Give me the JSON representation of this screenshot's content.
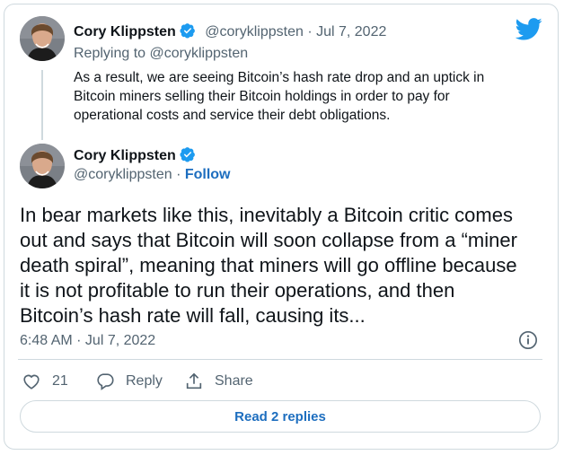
{
  "quoted_tweet": {
    "author_name": "Cory Klippsten",
    "handle": "@coryklippsten",
    "date_separator": " · ",
    "date": "Jul 7, 2022",
    "replying_prefix": "Replying to ",
    "replying_to": "@coryklippsten",
    "text_lines": [
      "As a result, we are seeing Bitcoin’s hash rate drop and an uptick in",
      "Bitcoin miners selling their Bitcoin holdings in order to pay for",
      "operational costs and service their debt obligations."
    ]
  },
  "main_tweet": {
    "author_name": "Cory Klippsten",
    "handle": "@coryklippsten",
    "follow_separator": " · ",
    "follow_label": "Follow",
    "text_lines": [
      "In bear markets like this, inevitably a Bitcoin critic comes",
      "out and says that Bitcoin will soon collapse from a “miner",
      "death spiral”, meaning that miners will go offline because",
      "it is not profitable to run their operations, and then",
      "Bitcoin’s hash rate will fall, causing its..."
    ],
    "timestamp": "6:48 AM · Jul 7, 2022"
  },
  "actions": {
    "like_count": "21",
    "reply_label": "Reply",
    "share_label": "Share"
  },
  "read_replies_label": "Read 2 replies",
  "colors": {
    "accent": "#1d9bf0",
    "link": "#1d6ebf",
    "secondary_text": "#536471",
    "border": "#cfd9de"
  },
  "icons": [
    "twitter-bird-icon",
    "verified-badge-icon",
    "heart-icon",
    "reply-bubble-icon",
    "share-icon",
    "info-icon"
  ]
}
